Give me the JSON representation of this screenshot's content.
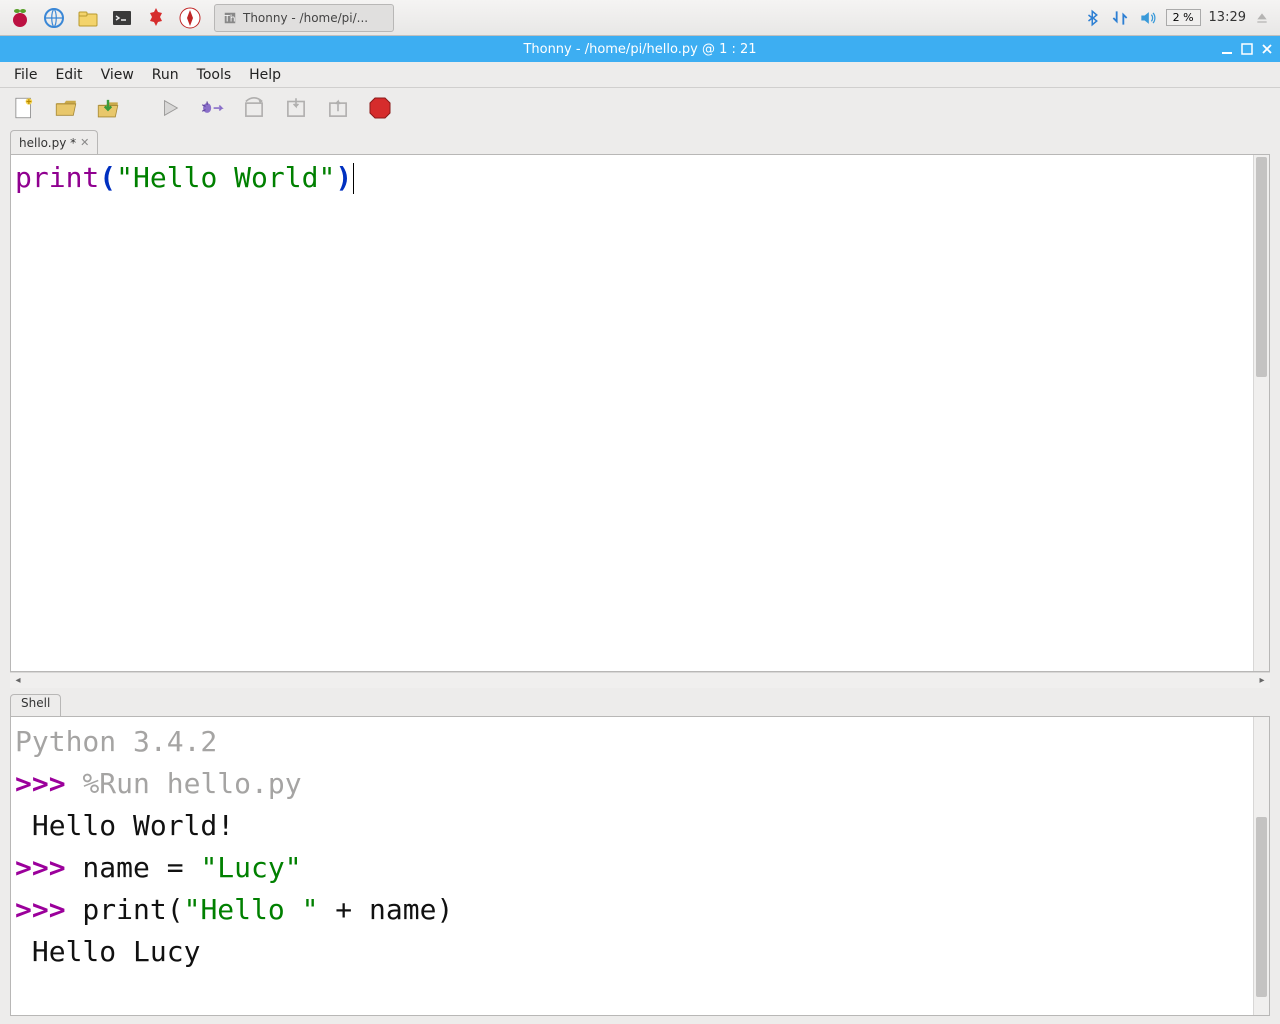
{
  "taskbar": {
    "icons": [
      "raspberry",
      "globe",
      "folder",
      "terminal",
      "mines",
      "wolfram"
    ],
    "app_button_label": "Thonny  -  /home/pi/...",
    "cpu_percent": "2 %",
    "clock": "13:29"
  },
  "window": {
    "title": "Thonny  -  /home/pi/hello.py  @  1 : 21"
  },
  "menu": {
    "items": [
      "File",
      "Edit",
      "View",
      "Run",
      "Tools",
      "Help"
    ]
  },
  "toolbar": {
    "buttons": [
      "new-file",
      "open-file",
      "save-file",
      "run",
      "debug",
      "step-over",
      "step-into",
      "resume",
      "stop"
    ]
  },
  "editor": {
    "tab_label": "hello.py *",
    "code": {
      "fn": "print",
      "lparen": "(",
      "string": "\"Hello World\"",
      "rparen": ")"
    }
  },
  "shell": {
    "tab_label": "Shell",
    "python_version": "Python 3.4.2",
    "prompt": ">>>",
    "lines": {
      "run_cmd": "%Run hello.py",
      "out1": " Hello World!",
      "line2_code": {
        "pre": " name = ",
        "str": "\"Lucy\""
      },
      "line3_code": {
        "pre": " print(",
        "str": "\"Hello \"",
        "post": " + name)"
      },
      "out2": " Hello Lucy"
    }
  }
}
